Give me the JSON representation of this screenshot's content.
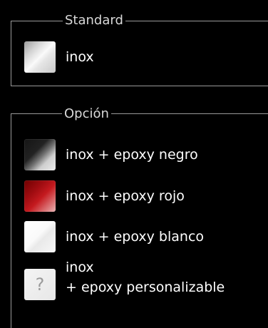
{
  "sections": {
    "standard": {
      "title": "Standard",
      "items": [
        {
          "label": "inox",
          "swatch": "inox-swatch"
        }
      ]
    },
    "option": {
      "title": "Opción",
      "items": [
        {
          "label": "inox + epoxy negro",
          "swatch": "black-epoxy-swatch"
        },
        {
          "label": "inox + epoxy rojo",
          "swatch": "red-epoxy-swatch"
        },
        {
          "label": "inox + epoxy blanco",
          "swatch": "white-epoxy-swatch"
        },
        {
          "label_line1": "inox",
          "label_line2": "+ epoxy personalizable",
          "swatch_glyph": "?"
        }
      ]
    }
  },
  "colors": {
    "background": "#000000",
    "border": "#9a9a9a",
    "legend_text": "#d8d8d8",
    "label_text": "#ffffff"
  }
}
